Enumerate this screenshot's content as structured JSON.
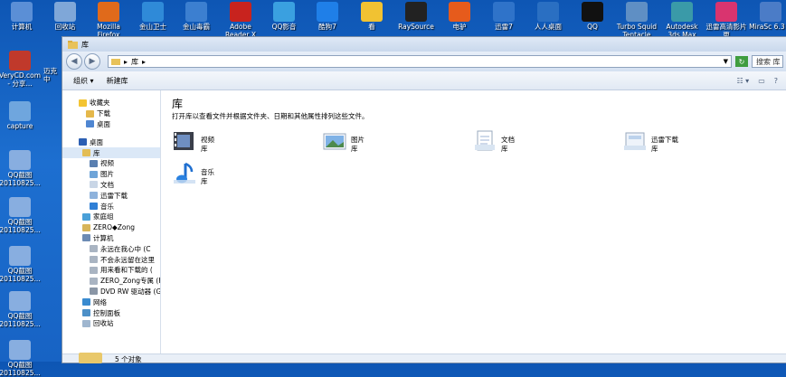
{
  "desktop": {
    "top_icons": [
      {
        "label": "计算机",
        "icon": "computer-icon",
        "color": "#5b8fd6"
      },
      {
        "label": "回收站",
        "icon": "recycle-bin-icon",
        "color": "#7fa7d8"
      },
      {
        "label": "Mozilla Firefox",
        "icon": "firefox-icon",
        "color": "#e06a1b"
      },
      {
        "label": "金山卫士",
        "icon": "shield-icon",
        "color": "#2f8ad8"
      },
      {
        "label": "金山毒霸",
        "icon": "antivirus-icon",
        "color": "#3c7fd0"
      },
      {
        "label": "Adobe Reader X",
        "icon": "pdf-icon",
        "color": "#c8231e"
      },
      {
        "label": "QQ影音",
        "icon": "video-player-icon",
        "color": "#3aa0e0"
      },
      {
        "label": "酷狗7",
        "icon": "music-icon",
        "color": "#1f7fe8"
      },
      {
        "label": "看",
        "icon": "face-icon",
        "color": "#f1c232"
      },
      {
        "label": "RaySource",
        "icon": "download-icon",
        "color": "#222222"
      },
      {
        "label": "电驴",
        "icon": "donkey-icon",
        "color": "#e65b1c"
      },
      {
        "label": "迅雷7",
        "icon": "thunder-icon",
        "color": "#2f73c9"
      },
      {
        "label": "人人桌面",
        "icon": "renren-icon",
        "color": "#2a6fc2"
      },
      {
        "label": "QQ",
        "icon": "penguin-icon",
        "color": "#111111"
      },
      {
        "label": "Turbo Squid Tentacle",
        "icon": "squid-icon",
        "color": "#5f8fc4"
      },
      {
        "label": "Autodesk 3ds Max",
        "icon": "3dsmax-icon",
        "color": "#3a9aa8"
      },
      {
        "label": "迅雷高清影片更",
        "icon": "hd-video-icon",
        "color": "#d9346f"
      },
      {
        "label": "MiraSc 6.3 ()",
        "icon": "mira-icon",
        "color": "#4b7cc7"
      }
    ],
    "left_icons": [
      {
        "label": "VeryCD.com - 分享...",
        "icon": "verycd-icon",
        "color": "#c0392b"
      },
      {
        "label": "capture",
        "icon": "image-file-icon",
        "color": "#6fa6de"
      },
      {
        "label": "QQ截图 20110825...",
        "icon": "screenshot-icon",
        "color": "#88aee0"
      },
      {
        "label": "QQ截图 20110825...",
        "icon": "screenshot-icon",
        "color": "#88aee0"
      },
      {
        "label": "QQ截图 20110825...",
        "icon": "screenshot-icon",
        "color": "#88aee0"
      },
      {
        "label": "QQ截图 20110825...",
        "icon": "screenshot-icon",
        "color": "#88aee0"
      },
      {
        "label": "QQ截图 20110825...",
        "icon": "screenshot-icon",
        "color": "#88aee0"
      }
    ],
    "partial_label": "迈克 中"
  },
  "window": {
    "title": "库",
    "address": {
      "root": "库"
    },
    "search_placeholder": "搜索 库",
    "toolbar": {
      "organize": "组织 ▾",
      "new_library": "新建库"
    },
    "nav": {
      "favorites": {
        "label": "收藏夹",
        "items": [
          "下载",
          "桌面"
        ]
      },
      "desktop": "桌面",
      "libraries": {
        "label": "库",
        "items": [
          "视频",
          "图片",
          "文档",
          "迅雷下载",
          "音乐"
        ]
      },
      "homegroup": "家庭组",
      "user": "ZERO◆Zong",
      "computer": {
        "label": "计算机",
        "drives": [
          "永远在我心中 (C",
          "不会永远留在这里",
          "用来看和下载的 (",
          "ZERO_Zong专属 (F",
          "DVD RW 驱动器 (G"
        ]
      },
      "network": "网络",
      "control_panel": "控制面板",
      "recycle_bin": "回收站"
    },
    "content": {
      "heading": "库",
      "description": "打开库以查看文件并根据文件夹、日期和其他属性排列这些文件。",
      "libraries": [
        {
          "name": "视频",
          "type": "库",
          "icon": "video-library-icon"
        },
        {
          "name": "图片",
          "type": "库",
          "icon": "picture-library-icon"
        },
        {
          "name": "文档",
          "type": "库",
          "icon": "document-library-icon"
        },
        {
          "name": "迅雷下载",
          "type": "库",
          "icon": "download-library-icon"
        },
        {
          "name": "音乐",
          "type": "库",
          "icon": "music-library-icon"
        }
      ]
    },
    "status": "5 个对象"
  }
}
